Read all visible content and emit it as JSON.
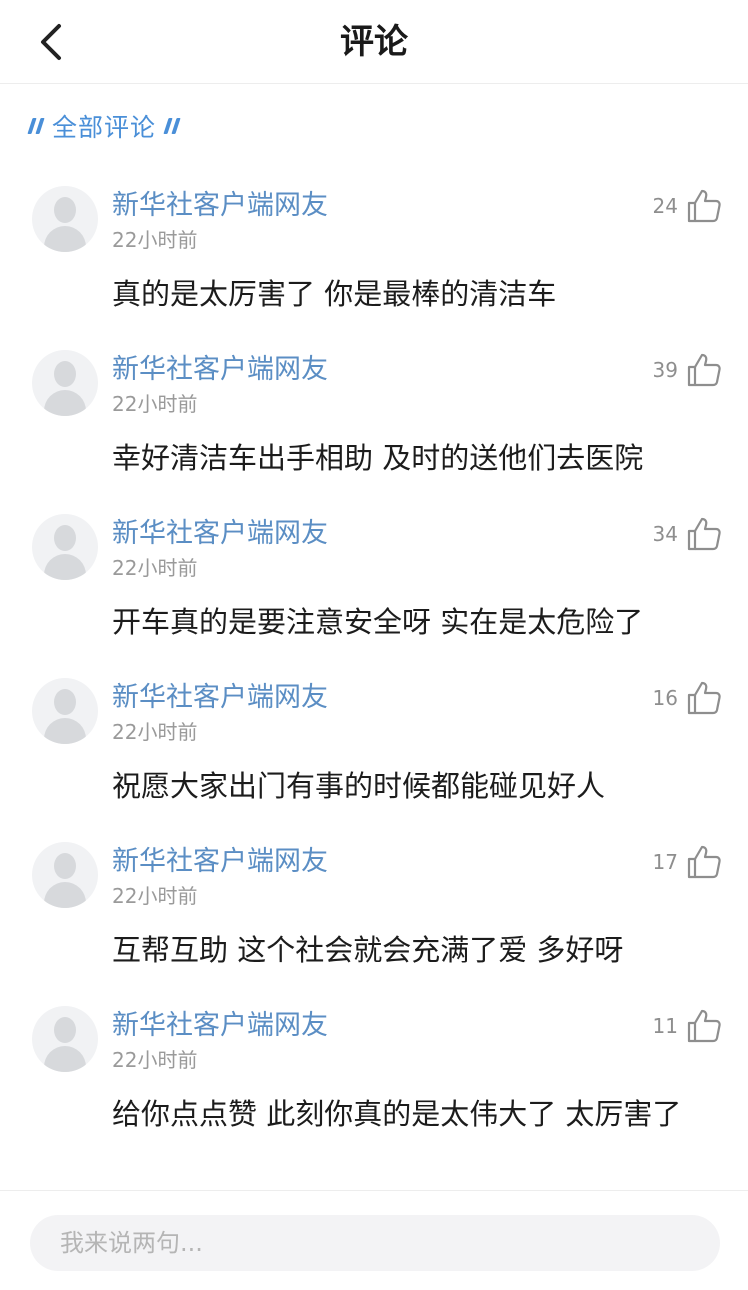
{
  "header": {
    "title": "评论",
    "back_icon": "chevron-left-icon"
  },
  "section": {
    "title": "全部评论",
    "accent": "#4a8fd8"
  },
  "comments": [
    {
      "user": "新华社客户端网友",
      "time": "22小时前",
      "likes": "24",
      "text": "真的是太厉害了 你是最棒的清洁车"
    },
    {
      "user": "新华社客户端网友",
      "time": "22小时前",
      "likes": "39",
      "text": "幸好清洁车出手相助 及时的送他们去医院"
    },
    {
      "user": "新华社客户端网友",
      "time": "22小时前",
      "likes": "34",
      "text": "开车真的是要注意安全呀 实在是太危险了"
    },
    {
      "user": "新华社客户端网友",
      "time": "22小时前",
      "likes": "16",
      "text": "祝愿大家出门有事的时候都能碰见好人"
    },
    {
      "user": "新华社客户端网友",
      "time": "22小时前",
      "likes": "17",
      "text": "互帮互助 这个社会就会充满了爱 多好呀"
    },
    {
      "user": "新华社客户端网友",
      "time": "22小时前",
      "likes": "11",
      "text": "给你点点赞 此刻你真的是太伟大了 太厉害了"
    }
  ],
  "reply": {
    "placeholder": "我来说两句..."
  },
  "colors": {
    "username": "#5b8ec4",
    "time": "#9a9a9a",
    "like_icon": "#8e8e8e"
  }
}
